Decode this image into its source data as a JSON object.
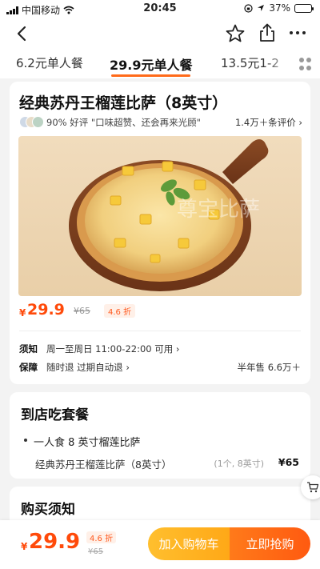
{
  "status_bar": {
    "carrier": "中国移动",
    "time": "20:45",
    "battery": "37%",
    "battery_level": 0.37,
    "icons": [
      "signal-icon",
      "wifi-icon",
      "location-icon",
      "lock-rotation-icon",
      "battery-icon"
    ]
  },
  "nav": {
    "icons": [
      "back-arrow-icon",
      "star-icon",
      "share-icon",
      "more-icon"
    ]
  },
  "tabs": [
    {
      "label": "6.2元单人餐"
    },
    {
      "label": "29.9元单人餐"
    },
    {
      "label": "13.5元1-2"
    }
  ],
  "product": {
    "title": "经典苏丹王榴莲比萨（8英寸）",
    "rating": "90% 好评 \"口味超赞、还会再来光顾\"",
    "reviews": "1.4万＋条评价",
    "image_watermark": "尊宝比萨",
    "currency": "¥",
    "price": "29.9",
    "original_price": "¥65",
    "discount": "4.6 折",
    "notice_label": "须知",
    "notice_value": "周一至周日 11:00-22:00 可用",
    "guarantee_label": "保障",
    "guarantee_value": "随时退  过期自动退",
    "sales": "半年售 6.6万＋"
  },
  "package": {
    "section_title": "到店吃套餐",
    "group_name": "一人食 8 英寸榴莲比萨",
    "item_name": "经典苏丹王榴莲比萨（8英寸）",
    "item_qty": "(1个, 8英寸)",
    "item_price": "¥65"
  },
  "notice": {
    "section_title": "购买须知"
  },
  "bottom_bar": {
    "currency": "¥",
    "price": "29.9",
    "discount": "4.6 折",
    "original_price": "¥65",
    "add_cart_label": "加入购物车",
    "buy_now_label": "立即抢购"
  },
  "colors": {
    "accent": "#ff5a10",
    "accent_light": "#ffa817",
    "tab_underline": "#ff6a1a",
    "price": "#ff4a0a"
  }
}
